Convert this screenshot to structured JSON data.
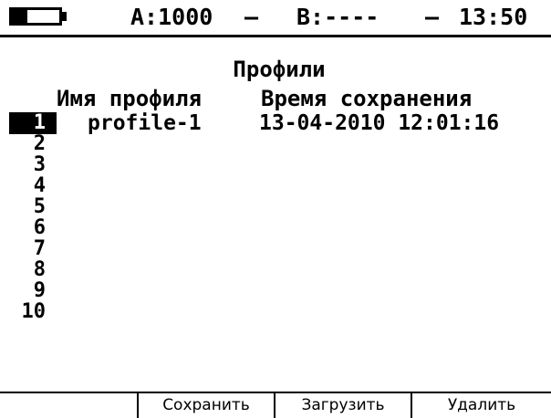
{
  "status_bar": {
    "battery_level": 0.33,
    "channel_a": "A:1000",
    "sep1": "–",
    "channel_b": "B:----",
    "sep2": "–",
    "time": "13:50"
  },
  "title": "Профили",
  "columns": {
    "name": "Имя профиля",
    "time": "Время сохранения"
  },
  "rows": [
    {
      "index": "1",
      "name": "profile-1",
      "saved": "13-04-2010 12:01:16",
      "selected": true
    },
    {
      "index": "2",
      "name": "",
      "saved": ""
    },
    {
      "index": "3",
      "name": "",
      "saved": ""
    },
    {
      "index": "4",
      "name": "",
      "saved": ""
    },
    {
      "index": "5",
      "name": "",
      "saved": ""
    },
    {
      "index": "6",
      "name": "",
      "saved": ""
    },
    {
      "index": "7",
      "name": "",
      "saved": ""
    },
    {
      "index": "8",
      "name": "",
      "saved": ""
    },
    {
      "index": "9",
      "name": "",
      "saved": ""
    },
    {
      "index": "10",
      "name": "",
      "saved": ""
    }
  ],
  "function_keys": [
    "",
    "Сохранить",
    "Загрузить",
    "Удалить"
  ]
}
